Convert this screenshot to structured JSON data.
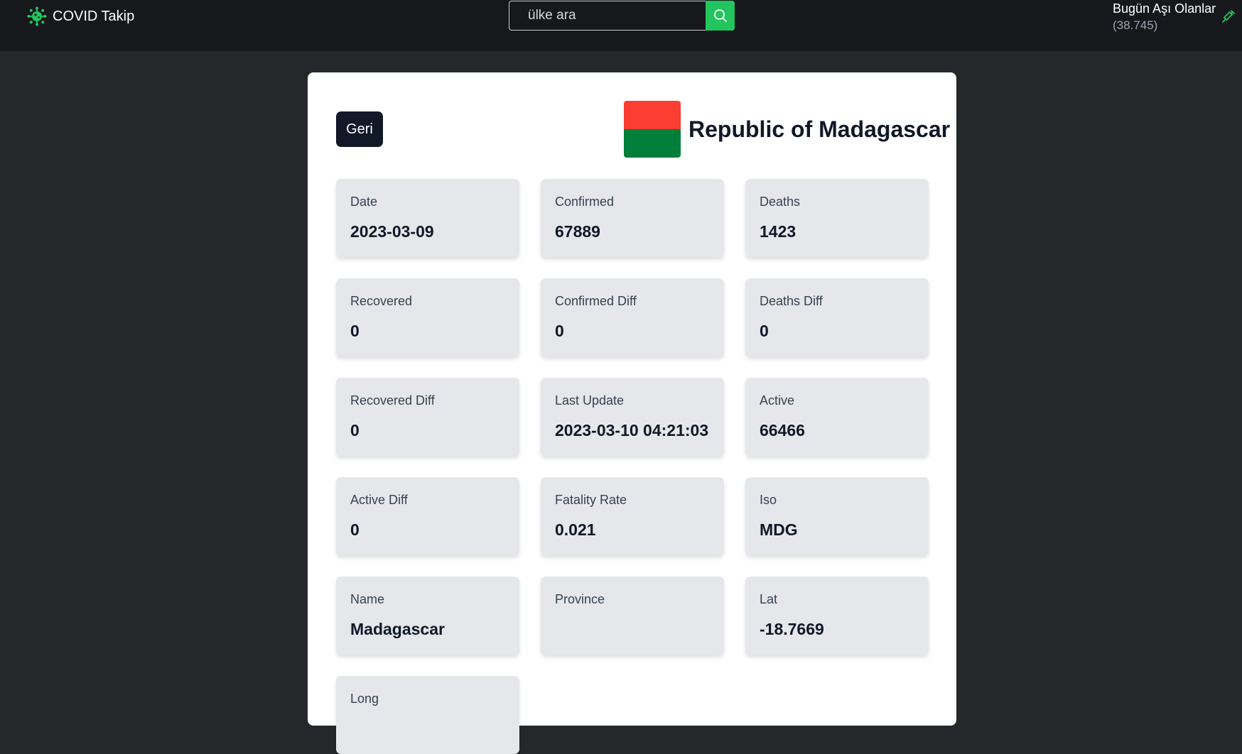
{
  "header": {
    "brand": "COVID Takip",
    "search_placeholder": "ülke ara",
    "vaccinated_label": "Bugün Aşı Olanlar",
    "vaccinated_count": "(38.745)"
  },
  "colors": {
    "accent": "#22c55e",
    "header_bg": "#17181c",
    "page_bg": "#26272b",
    "flag_top": "#fc3d32",
    "flag_bottom": "#007e3a"
  },
  "detail": {
    "back_label": "Geri",
    "country": "Republic of Madagascar",
    "stats": [
      {
        "label": "Date",
        "value": "2023-03-09"
      },
      {
        "label": "Confirmed",
        "value": "67889"
      },
      {
        "label": "Deaths",
        "value": "1423"
      },
      {
        "label": "Recovered",
        "value": "0"
      },
      {
        "label": "Confirmed Diff",
        "value": "0"
      },
      {
        "label": "Deaths Diff",
        "value": "0"
      },
      {
        "label": "Recovered Diff",
        "value": "0"
      },
      {
        "label": "Last Update",
        "value": "2023-03-10 04:21:03"
      },
      {
        "label": "Active",
        "value": "66466"
      },
      {
        "label": "Active Diff",
        "value": "0"
      },
      {
        "label": "Fatality Rate",
        "value": "0.021"
      },
      {
        "label": "Iso",
        "value": "MDG"
      },
      {
        "label": "Name",
        "value": "Madagascar"
      },
      {
        "label": "Province",
        "value": ""
      },
      {
        "label": "Lat",
        "value": "-18.7669"
      },
      {
        "label": "Long",
        "value": ""
      }
    ]
  }
}
